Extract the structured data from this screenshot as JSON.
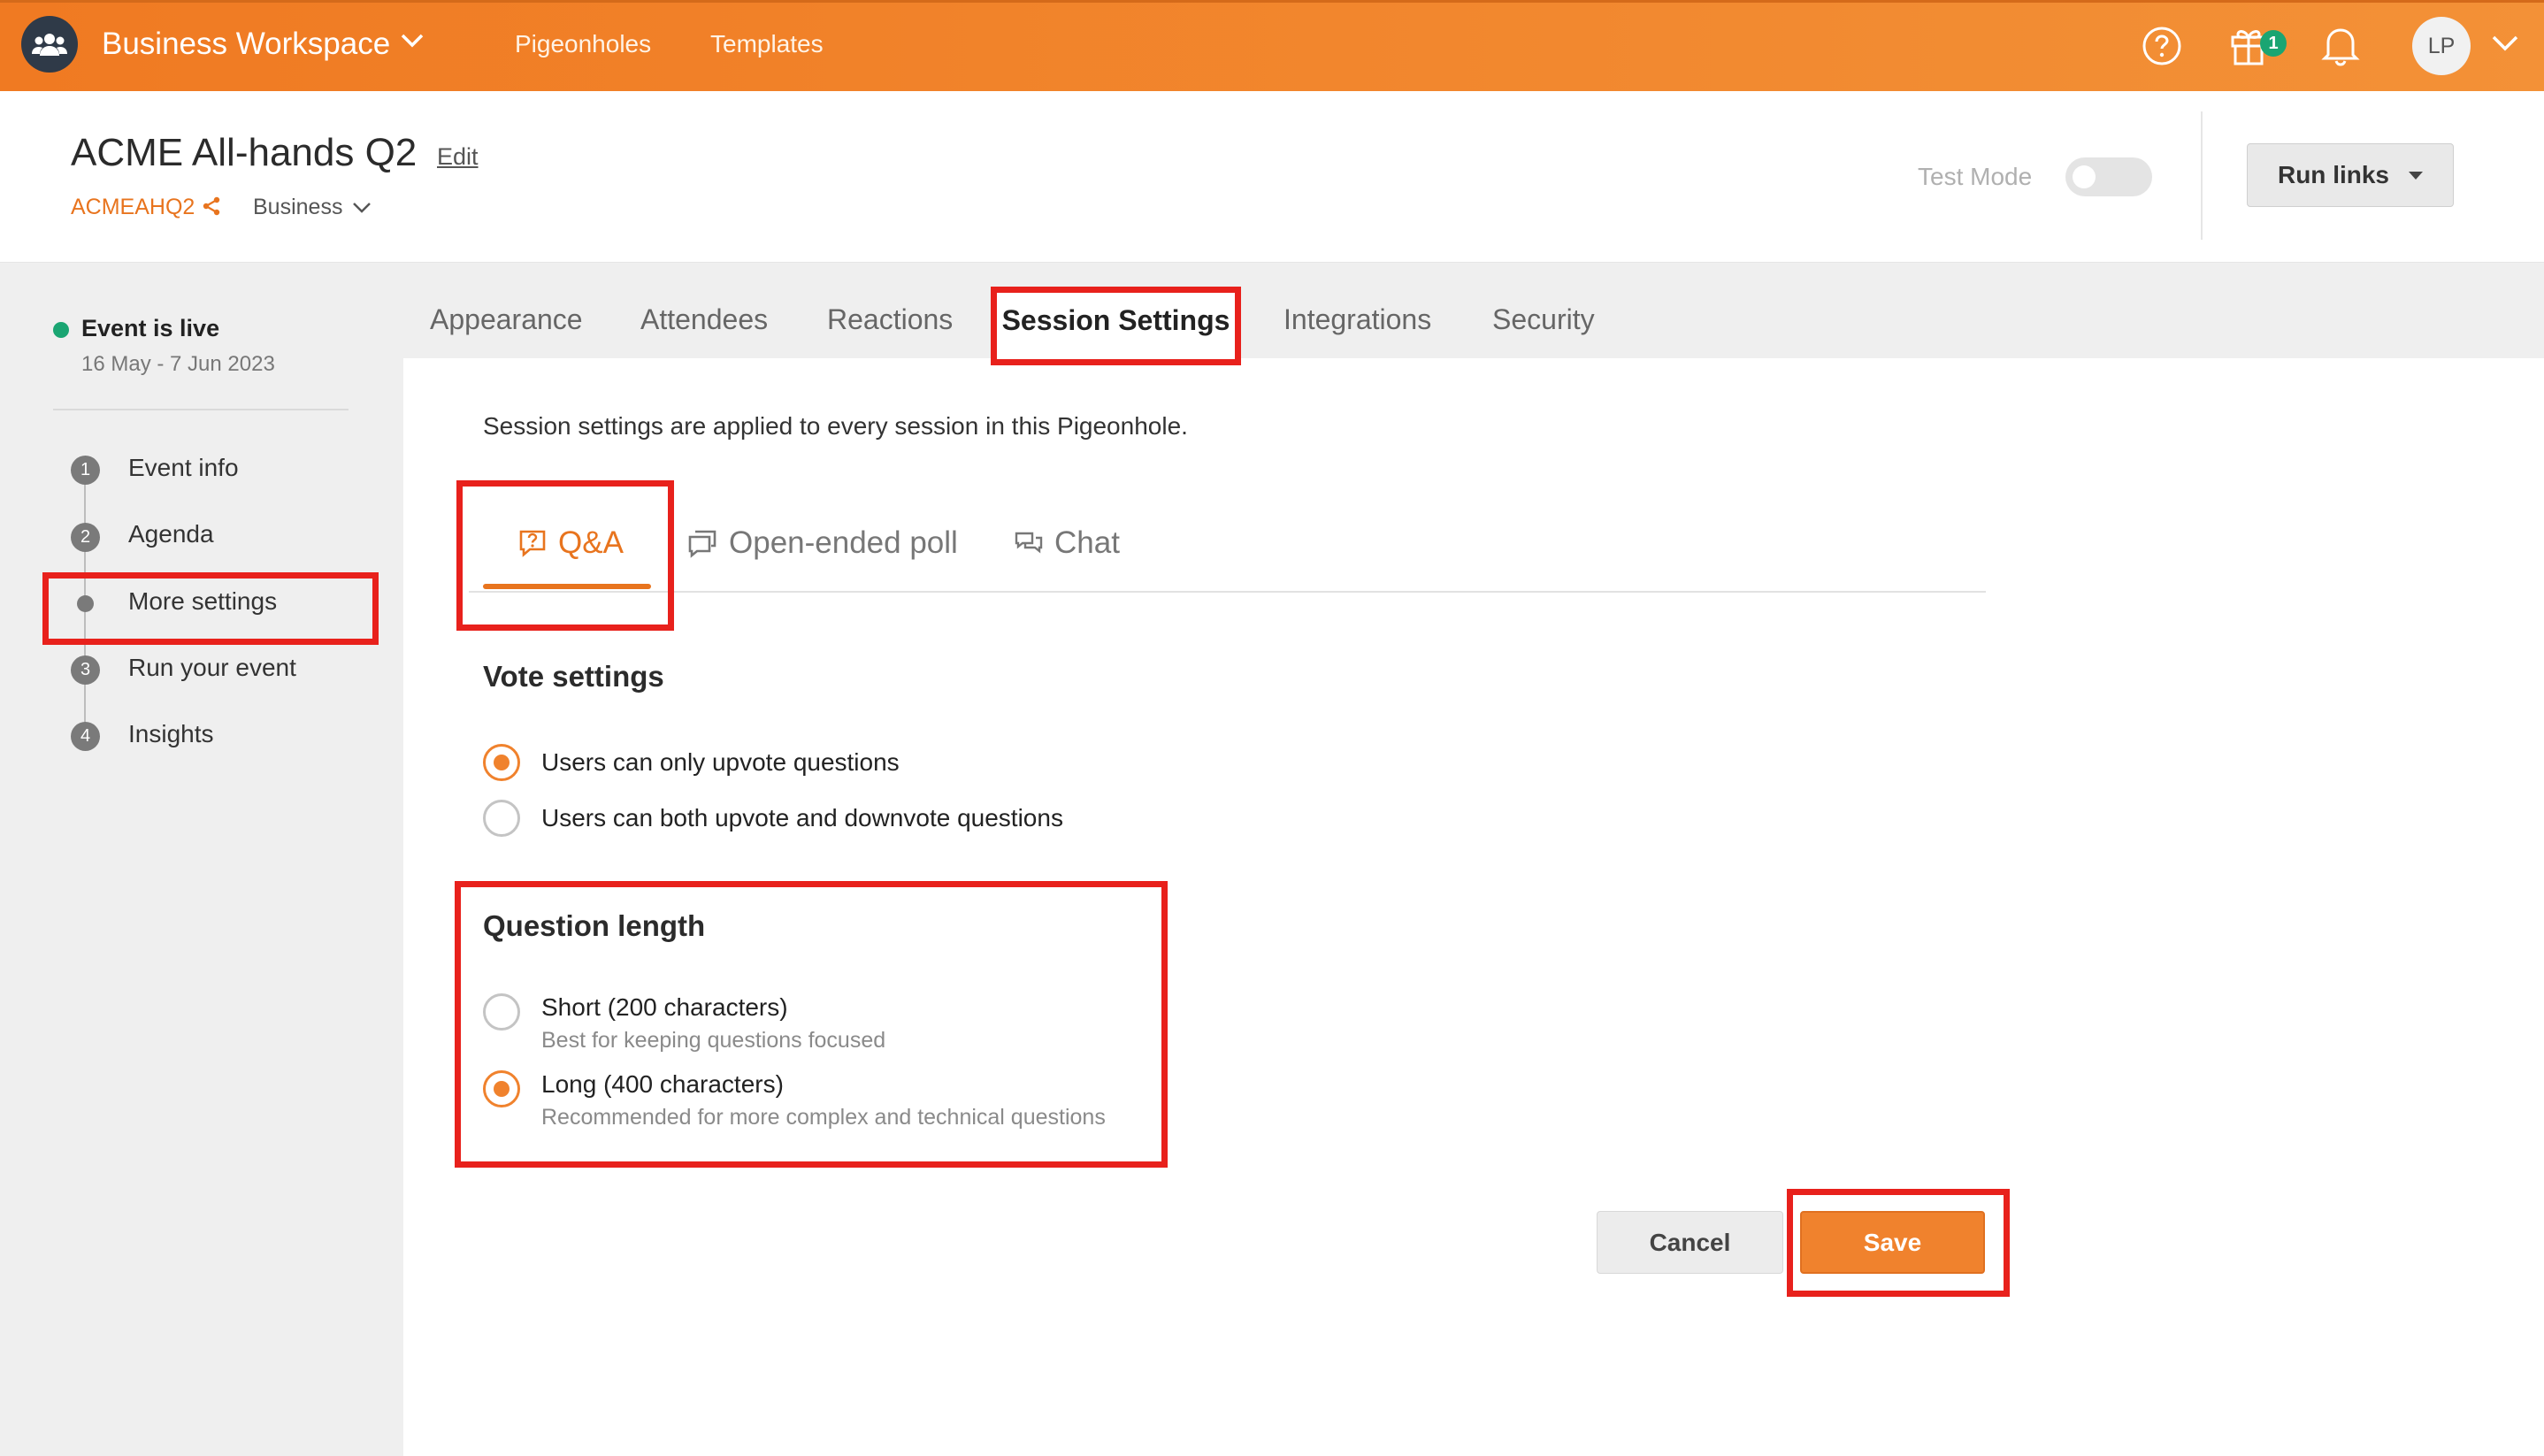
{
  "topbar": {
    "workspace_name": "Business Workspace",
    "nav": [
      "Pigeonholes",
      "Templates"
    ],
    "gift_count": "1",
    "avatar_initials": "LP"
  },
  "header": {
    "event_title": "ACME All-hands Q2",
    "edit_label": "Edit",
    "event_code": "ACMEAHQ2",
    "workspace_type": "Business",
    "test_mode_label": "Test Mode",
    "test_mode_on": false,
    "run_links_label": "Run links"
  },
  "sidebar": {
    "status_label": "Event is live",
    "status_dates": "16 May - 7 Jun 2023",
    "steps": [
      {
        "num": "1",
        "label": "Event info"
      },
      {
        "num": "2",
        "label": "Agenda"
      },
      {
        "num": "",
        "label": "More settings"
      },
      {
        "num": "3",
        "label": "Run your event"
      },
      {
        "num": "4",
        "label": "Insights"
      }
    ]
  },
  "tabs": [
    "Appearance",
    "Attendees",
    "Reactions",
    "Session Settings",
    "Integrations",
    "Security"
  ],
  "active_tab": "Session Settings",
  "session": {
    "note": "Session settings are applied to every session in this Pigeonhole.",
    "subtabs": [
      "Q&A",
      "Open-ended poll",
      "Chat"
    ],
    "active_subtab": "Q&A",
    "vote_heading": "Vote settings",
    "vote_options": [
      {
        "label": "Users can only upvote questions",
        "selected": true
      },
      {
        "label": "Users can both upvote and downvote questions",
        "selected": false
      }
    ],
    "length_heading": "Question length",
    "length_options": [
      {
        "label": "Short (200 characters)",
        "sub": "Best for keeping questions focused",
        "selected": false
      },
      {
        "label": "Long (400 characters)",
        "sub": "Recommended for more complex and technical questions",
        "selected": true
      }
    ]
  },
  "actions": {
    "cancel": "Cancel",
    "save": "Save"
  },
  "colors": {
    "brand_orange": "#f0822d",
    "live_green": "#1aa572",
    "highlight_red": "#e8211c"
  }
}
